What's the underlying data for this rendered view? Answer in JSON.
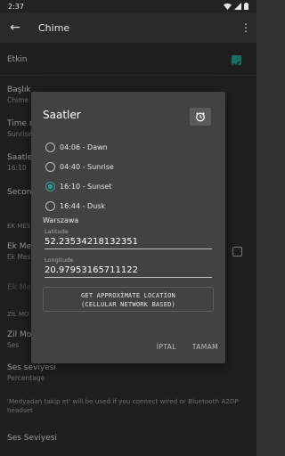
{
  "status": {
    "time": "2:37"
  },
  "appbar": {
    "title": "Chime"
  },
  "settings": {
    "row1": {
      "title": "Etkin"
    },
    "row2": {
      "title": "Başlık",
      "sub": "Chime"
    },
    "row3": {
      "title": "Time r",
      "sub": "Sunrise"
    },
    "row4": {
      "title": "Saatle",
      "sub": "16:10"
    },
    "row5": {
      "title": "Secon"
    },
    "row6": {
      "title": "EK MES"
    },
    "row7": {
      "title": "Ek Me",
      "sub": "Ek Mes"
    },
    "row8": {
      "title": "Ek Me"
    },
    "row9": {
      "title": "ZİL MO"
    },
    "row10": {
      "title": "Zil Mo",
      "sub": "Ses"
    },
    "row11": {
      "title": "Ses seviyesi",
      "sub": "Percentage"
    },
    "row12": {
      "title": "'Medyadan takip et' will be used if you connect wired or Bluetooth A2DP headset"
    },
    "row13": {
      "title": "Ses Seviyesi"
    }
  },
  "dialog": {
    "title": "Saatler",
    "options": [
      {
        "label": "04:06 - Dawn",
        "checked": false
      },
      {
        "label": "04:40 - Sunrise",
        "checked": false
      },
      {
        "label": "16:10 - Sunset",
        "checked": true
      },
      {
        "label": "16:44 - Dusk",
        "checked": false
      }
    ],
    "location_name": "Warszawa",
    "latitude_label": "Latitude",
    "latitude_value": "52.23534218132351",
    "longitude_label": "Longitude",
    "longitude_value": "20.97953165711122",
    "approx_line1": "GET APPROXİMATE LOCATİON",
    "approx_line2": "(CELLULAR NETWORK BASED)",
    "cancel_label": "İPTAL",
    "ok_label": "TAMAM"
  },
  "colors": {
    "accent": "#26a69a",
    "dialog_bg": "#424242",
    "page_bg": "#303030"
  }
}
